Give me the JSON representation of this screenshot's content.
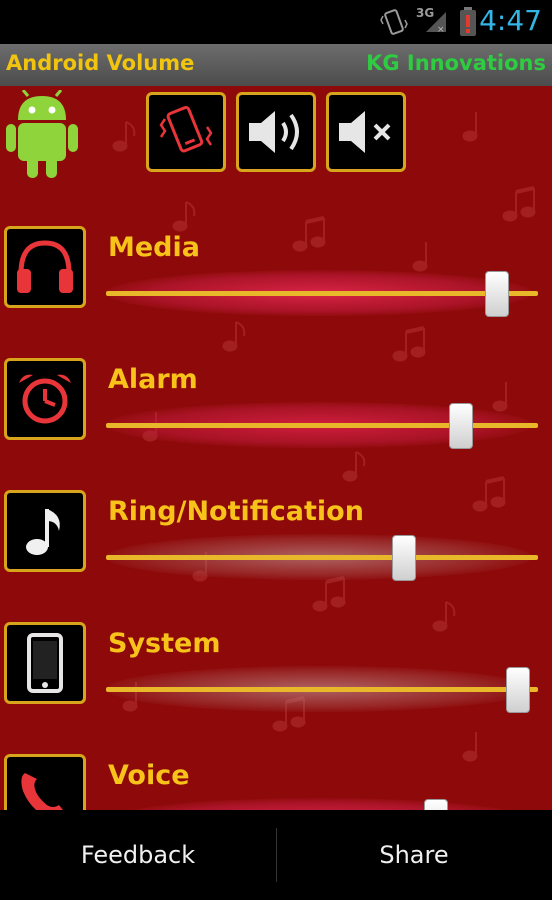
{
  "status_bar": {
    "time": "4:47",
    "network": "3G",
    "icons": [
      "vibrate-icon",
      "signal-icon",
      "battery-alert-icon"
    ]
  },
  "header": {
    "app_title": "Android Volume",
    "developer": "KG Innovations"
  },
  "modes": [
    {
      "name": "vibrate",
      "icon": "phone-vibrate-icon"
    },
    {
      "name": "sound",
      "icon": "speaker-on-icon"
    },
    {
      "name": "mute",
      "icon": "speaker-mute-icon"
    }
  ],
  "volumes": [
    {
      "label": "Media",
      "icon": "headphones-icon",
      "level": 0.93
    },
    {
      "label": "Alarm",
      "icon": "alarm-clock-icon",
      "level": 0.84
    },
    {
      "label": "Ring/Notification",
      "icon": "music-note-icon",
      "level": 0.7
    },
    {
      "label": "System",
      "icon": "smartphone-icon",
      "level": 0.98
    },
    {
      "label": "Voice",
      "icon": "phone-handset-icon",
      "level": 0.78
    }
  ],
  "bottom_bar": {
    "feedback_label": "Feedback",
    "share_label": "Share"
  },
  "colors": {
    "background": "#8e0a0a",
    "accent_gold": "#f7c21a",
    "icon_red": "#e8353a",
    "time_blue": "#33b5e5",
    "developer_green": "#2ecc40"
  }
}
